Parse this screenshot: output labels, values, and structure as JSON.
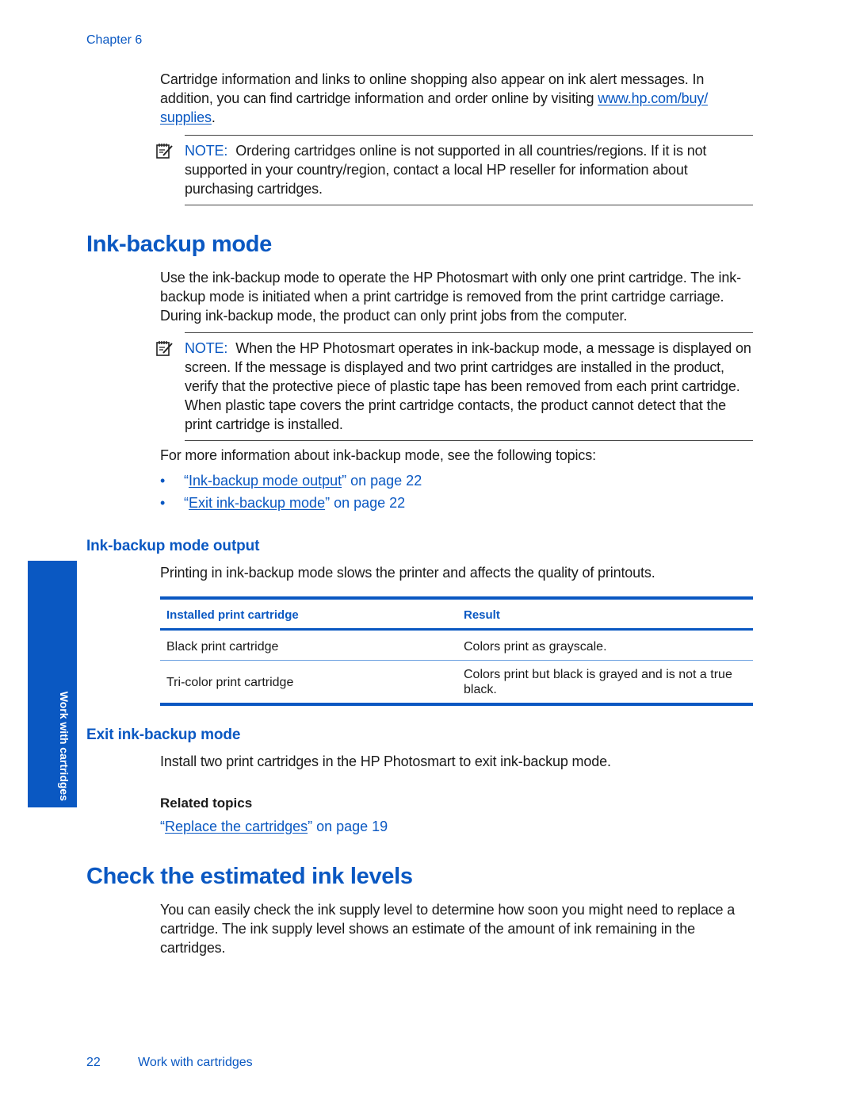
{
  "header": {
    "chapter": "Chapter 6"
  },
  "intro": {
    "text_before_link": "Cartridge information and links to online shopping also appear on ink alert messages. In addition, you can find cartridge information and order online by visiting ",
    "link_line1": "www.hp.com/buy/",
    "link_line2": "supplies",
    "text_after_link": "."
  },
  "note1": {
    "label": "NOTE:",
    "text": "Ordering cartridges online is not supported in all countries/regions. If it is not supported in your country/region, contact a local HP reseller for information about purchasing cartridges."
  },
  "section_ink_backup": {
    "title": "Ink-backup mode",
    "paragraph": "Use the ink-backup mode to operate the HP Photosmart with only one print cartridge. The ink-backup mode is initiated when a print cartridge is removed from the print cartridge carriage. During ink-backup mode, the product can only print jobs from the computer.",
    "note": {
      "label": "NOTE:",
      "text": "When the HP Photosmart operates in ink-backup mode, a message is displayed on screen. If the message is displayed and two print cartridges are installed in the product, verify that the protective piece of plastic tape has been removed from each print cartridge. When plastic tape covers the print cartridge contacts, the product cannot detect that the print cartridge is installed."
    },
    "more_info": "For more information about ink-backup mode, see the following topics:",
    "topics": [
      {
        "bullet": "•",
        "open_quote": "“",
        "link": "Ink-backup mode output",
        "tail": "” on page 22"
      },
      {
        "bullet": "•",
        "open_quote": "“",
        "link": "Exit ink-backup mode",
        "tail": "” on page 22"
      }
    ]
  },
  "section_output": {
    "title": "Ink-backup mode output",
    "paragraph": "Printing in ink-backup mode slows the printer and affects the quality of printouts.",
    "table": {
      "headers": [
        "Installed print cartridge",
        "Result"
      ],
      "rows": [
        [
          "Black print cartridge",
          "Colors print as grayscale."
        ],
        [
          "Tri-color print cartridge",
          "Colors print but black is grayed and is not a true black."
        ]
      ]
    }
  },
  "section_exit": {
    "title": "Exit ink-backup mode",
    "paragraph": "Install two print cartridges in the HP Photosmart to exit ink-backup mode.",
    "related_heading": "Related topics",
    "related_link": {
      "open_quote": "“",
      "link": "Replace the cartridges",
      "tail": "” on page 19"
    }
  },
  "section_ink_levels": {
    "title": "Check the estimated ink levels",
    "paragraph": "You can easily check the ink supply level to determine how soon you might need to replace a cartridge. The ink supply level shows an estimate of the amount of ink remaining in the cartridges."
  },
  "side_tab": {
    "label": "Work with cartridges"
  },
  "footer": {
    "page_number": "22",
    "section": "Work with cartridges"
  },
  "colors": {
    "accent": "#0a58c2",
    "text": "#1a1a1a",
    "rule": "#444444"
  }
}
